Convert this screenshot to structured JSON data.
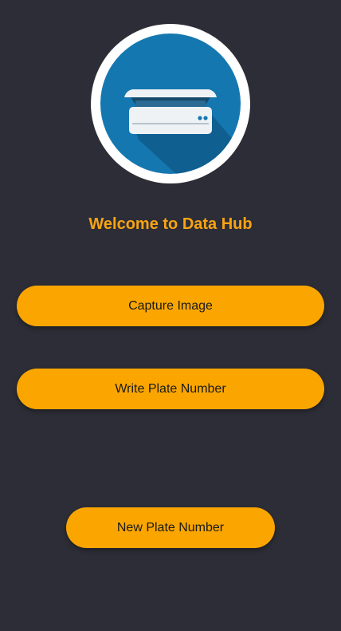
{
  "app": {
    "logo_icon": "scanner-icon",
    "welcome_text": "Welcome to Data Hub"
  },
  "buttons": {
    "capture_label": "Capture Image",
    "write_label": "Write Plate Number",
    "new_label": "New Plate Number"
  },
  "colors": {
    "background": "#2d2d37",
    "accent": "#fba600",
    "welcome_text": "#f7a412",
    "logo_blue": "#1577b0"
  }
}
